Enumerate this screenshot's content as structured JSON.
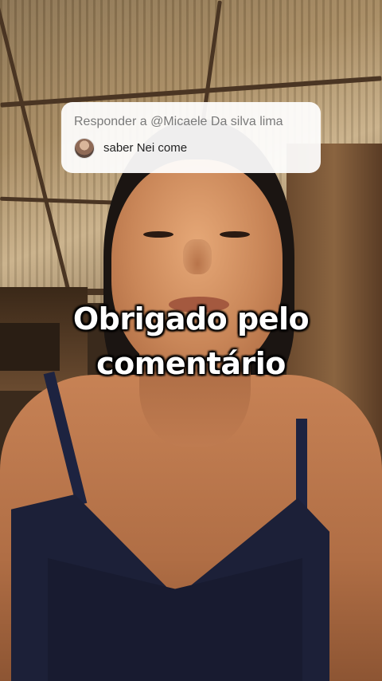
{
  "reply": {
    "title": "Responder a @Micaele Da silva lima",
    "comment_text": "saber Nei come",
    "avatar_icon": "user-avatar"
  },
  "caption": {
    "line1": "Obrigado pelo",
    "line2": "comentário"
  }
}
